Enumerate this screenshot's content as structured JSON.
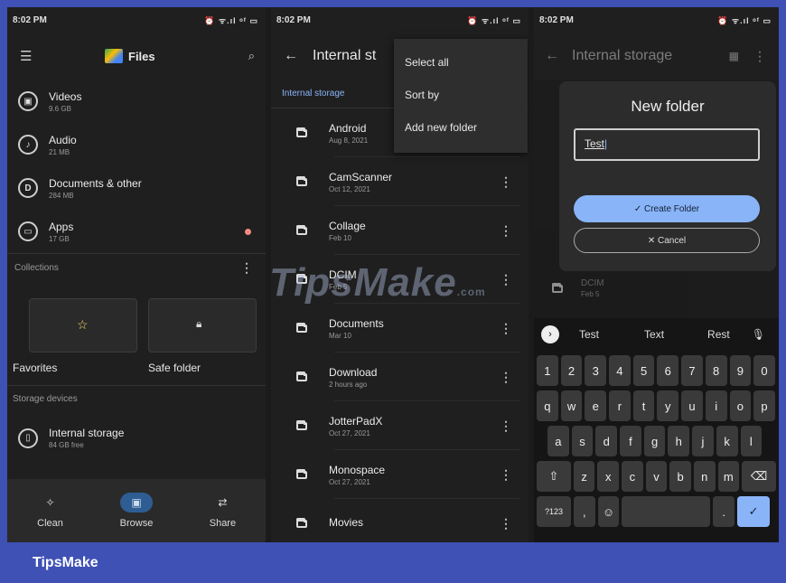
{
  "status": {
    "time": "8:02 PM",
    "icons": "⏰ ᯤ.ıl ᵒᶠ ▭"
  },
  "panel1": {
    "title": "Files",
    "categories": [
      {
        "name": "Videos",
        "size": "9.6 GB",
        "icon": "video-icon"
      },
      {
        "name": "Audio",
        "size": "21 MB",
        "icon": "audio-icon"
      },
      {
        "name": "Documents & other",
        "size": "284 MB",
        "icon": "document-icon"
      },
      {
        "name": "Apps",
        "size": "17 GB",
        "icon": "apps-icon"
      }
    ],
    "collections_label": "Collections",
    "favorites": "Favorites",
    "safe_folder": "Safe folder",
    "storage_devices_label": "Storage devices",
    "internal_storage": "Internal storage",
    "internal_free": "84 GB free",
    "nav": [
      "Clean",
      "Browse",
      "Share"
    ]
  },
  "panel2": {
    "title": "Internal st",
    "breadcrumb": "Internal storage",
    "menu": [
      "Select all",
      "Sort by",
      "Add new folder"
    ],
    "folders": [
      {
        "name": "Android",
        "date": "Aug 8, 2021"
      },
      {
        "name": "CamScanner",
        "date": "Oct 12, 2021"
      },
      {
        "name": "Collage",
        "date": "Feb 10"
      },
      {
        "name": "DCIM",
        "date": "Feb 5"
      },
      {
        "name": "Documents",
        "date": "Mar 10"
      },
      {
        "name": "Download",
        "date": "2 hours ago"
      },
      {
        "name": "JotterPadX",
        "date": "Oct 27, 2021"
      },
      {
        "name": "Monospace",
        "date": "Oct 27, 2021"
      },
      {
        "name": "Movies",
        "date": ""
      }
    ]
  },
  "panel3": {
    "title": "Internal storage",
    "dialog_title": "New folder",
    "input_value": "Test",
    "create_label": "✓  Create Folder",
    "cancel_label": "✕  Cancel",
    "bg_folder": {
      "name": "DCIM",
      "date": "Feb 5"
    },
    "suggestions": [
      "Test",
      "Text",
      "Rest"
    ],
    "numbers": [
      "1",
      "2",
      "3",
      "4",
      "5",
      "6",
      "7",
      "8",
      "9",
      "0"
    ],
    "row1": [
      "q",
      "w",
      "e",
      "r",
      "t",
      "y",
      "u",
      "i",
      "o",
      "p"
    ],
    "row2": [
      "a",
      "s",
      "d",
      "f",
      "g",
      "h",
      "j",
      "k",
      "l"
    ],
    "row3": [
      "z",
      "x",
      "c",
      "v",
      "b",
      "n",
      "m"
    ],
    "sym_key": "?123",
    "comma_key": ",",
    "period_key": "."
  },
  "watermark": "TipsMake",
  "watermark_suffix": ".com",
  "footer": "TipsMake",
  "colors": {
    "accent": "#8ab4f8",
    "brand": "#3f51b5",
    "badge": "#f28b82"
  }
}
